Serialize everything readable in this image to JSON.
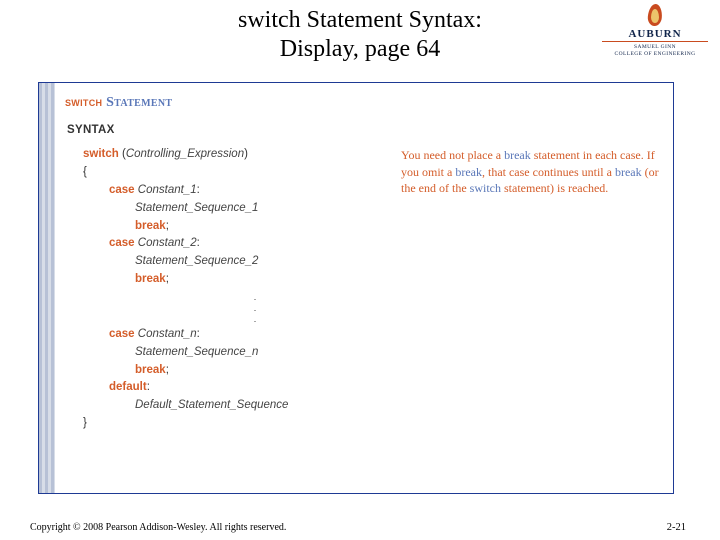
{
  "header": {
    "title_l1": "switch Statement Syntax:",
    "title_l2": "Display, page 64"
  },
  "logo": {
    "name": "AUBURN",
    "sub1": "SAMUEL GINN",
    "sub2": "COLLEGE OF ENGINEERING"
  },
  "figure": {
    "title_prefix": "switch",
    "title_rest": " Statement",
    "syntax_label": "SYNTAX",
    "kw_switch": "switch",
    "paren_open": " (",
    "ctrl_expr": "Controlling_Expression",
    "paren_close": ")",
    "brace_open": "{",
    "kw_case": "case",
    "const1": " Constant_1",
    "colon": ":",
    "stmt1": "Statement_Sequence_1",
    "kw_break": "break",
    "semi": ";",
    "const2": " Constant_2",
    "stmt2": "Statement_Sequence_2",
    "dot": ".",
    "constn": " Constant_n",
    "stmtn": "Statement_Sequence_n",
    "kw_default": "default",
    "def_stmt": "Default_Statement_Sequence",
    "brace_close": "}",
    "callout": {
      "t1": "You need not place a ",
      "b1": "break",
      "t2": " statement in each case. If you omit a ",
      "b2": "break",
      "t3": ", that case continues until a ",
      "b3": "break",
      "t4": " (or the end of the ",
      "b4": "switch",
      "t5": " statement) is reached."
    }
  },
  "footer": {
    "copyright": "Copyright © 2008 Pearson Addison-Wesley. All rights reserved.",
    "slide": "2-21"
  }
}
